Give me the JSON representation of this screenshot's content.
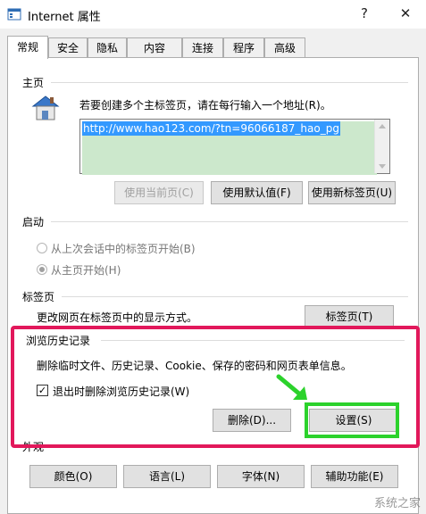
{
  "window": {
    "title": "Internet 属性",
    "help_label": "?",
    "close_label": "✕"
  },
  "tabs": [
    {
      "label": "常规",
      "active": true
    },
    {
      "label": "安全"
    },
    {
      "label": "隐私"
    },
    {
      "label": "内容"
    },
    {
      "label": "连接"
    },
    {
      "label": "程序"
    },
    {
      "label": "高级"
    }
  ],
  "home": {
    "section_label": "主页",
    "instruction": "若要创建多个主标签页，请在每行输入一个地址(R)。",
    "url_value": "http://www.hao123.com/?tn=96066187_hao_pg",
    "use_current_label": "使用当前页(C)",
    "use_default_label": "使用默认值(F)",
    "use_new_tab_label": "使用新标签页(U)"
  },
  "startup": {
    "section_label": "启动",
    "option_last_session": "从上次会话中的标签页开始(B)",
    "option_home": "从主页开始(H)",
    "selected": "home"
  },
  "tabs_section": {
    "section_label": "标签页",
    "description": "更改网页在标签页中的显示方式。",
    "button_label": "标签页(T)"
  },
  "history": {
    "section_label": "浏览历史记录",
    "description": "删除临时文件、历史记录、Cookie、保存的密码和网页表单信息。",
    "delete_on_exit_label": "退出时删除浏览历史记录(W)",
    "delete_on_exit_checked": true,
    "delete_button_label": "删除(D)...",
    "settings_button_label": "设置(S)"
  },
  "appearance": {
    "section_label": "外观",
    "colors_label": "颜色(O)",
    "languages_label": "语言(L)",
    "fonts_label": "字体(N)",
    "accessibility_label": "辅助功能(E)"
  },
  "watermark": "系统之家",
  "colors": {
    "highlight_red": "#e2185b",
    "highlight_green": "#2cd22c",
    "selection_blue": "#3399ff"
  }
}
